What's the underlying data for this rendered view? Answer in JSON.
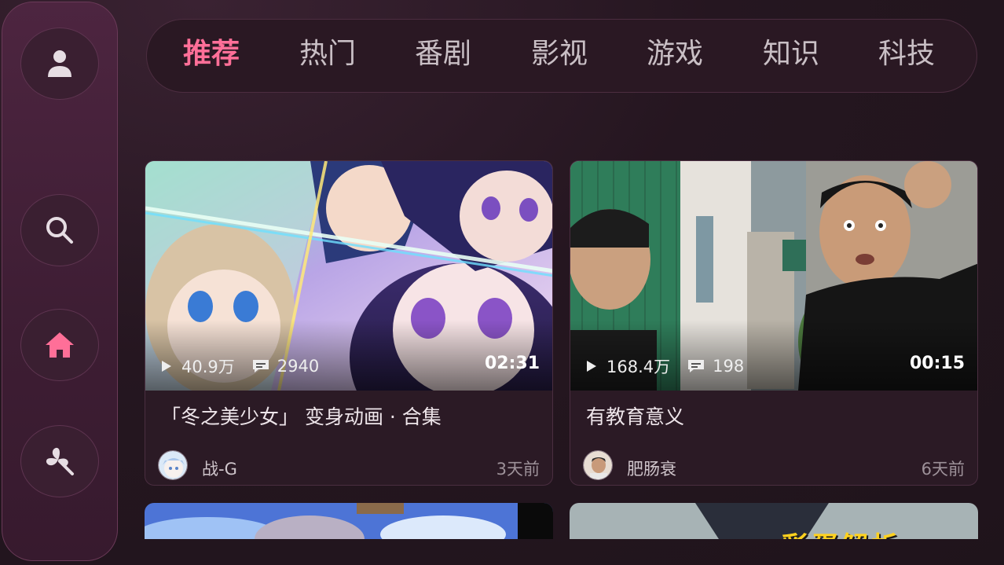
{
  "tabs": [
    {
      "label": "推荐",
      "active": true
    },
    {
      "label": "热门"
    },
    {
      "label": "番剧"
    },
    {
      "label": "影视"
    },
    {
      "label": "游戏"
    },
    {
      "label": "知识"
    },
    {
      "label": "科技"
    }
  ],
  "sidebar": {
    "items": [
      {
        "icon": "user-icon"
      },
      {
        "icon": "search-icon"
      },
      {
        "icon": "home-icon",
        "active": true
      },
      {
        "icon": "pinwheel-icon"
      }
    ]
  },
  "colors": {
    "accent": "#ff6f98",
    "background": "#241620",
    "sidebar": "#4d2540"
  },
  "videos": [
    {
      "views": "40.9万",
      "comments": "2940",
      "duration": "02:31",
      "title": "「冬之美少女」 变身动画 · 合集",
      "author": "战-G",
      "time": "3天前"
    },
    {
      "views": "168.4万",
      "comments": "198",
      "duration": "00:15",
      "title": "有教育意义",
      "author": "肥肠衰",
      "time": "6天前"
    }
  ],
  "partial_cards": [
    {
      "thumb_text": ""
    },
    {
      "thumb_text": "彩蛋解析"
    }
  ]
}
